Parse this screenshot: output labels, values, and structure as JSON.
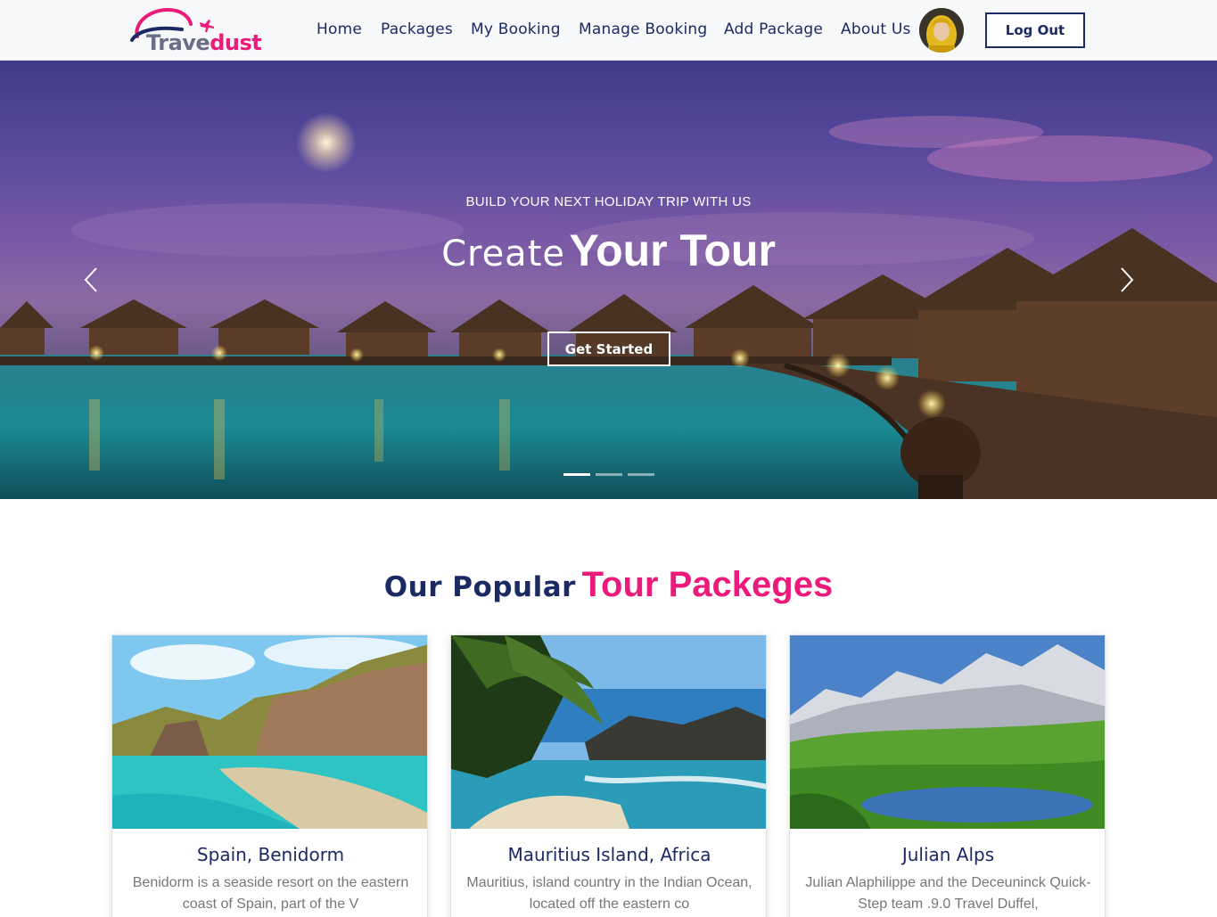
{
  "brand": {
    "name_part1": "Trave",
    "name_part2": "dust"
  },
  "nav": {
    "links": [
      "Home",
      "Packages",
      "My Booking",
      "Manage Booking",
      "Add Package",
      "About Us"
    ],
    "logout_label": "Log Out"
  },
  "hero": {
    "subtitle": "BUILD YOUR NEXT HOLIDAY TRIP WITH US",
    "title_light": "Create",
    "title_bold": "Your Tour",
    "cta_label": "Get Started",
    "slide_count": 3,
    "active_slide": 1
  },
  "section": {
    "title_part1": "Our Popular",
    "title_part2": "Tour Packeges"
  },
  "packages": [
    {
      "title": "Spain, Benidorm",
      "description": "Benidorm is a seaside resort on the eastern coast of Spain, part of the V"
    },
    {
      "title": "Mauritius Island, Africa",
      "description": "Mauritius, island country in the Indian Ocean, located off the eastern co"
    },
    {
      "title": "Julian Alps",
      "description": "Julian Alaphilippe and the Deceuninck Quick-Step team .9.0 Travel Duffel,"
    }
  ],
  "colors": {
    "navy": "#1c2a64",
    "accent_pink": "#ec1a7a",
    "muted_text": "#777777"
  }
}
